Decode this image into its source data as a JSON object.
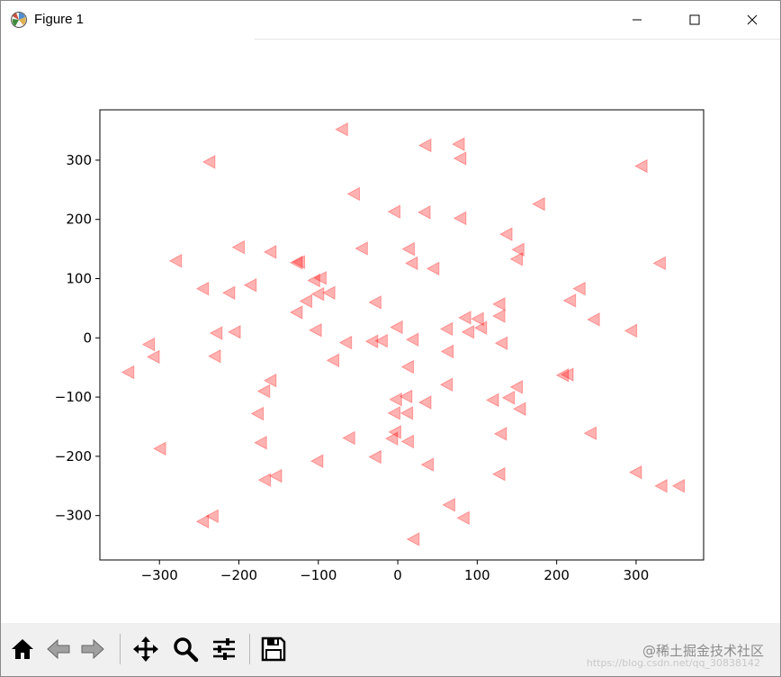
{
  "window": {
    "title": "Figure 1",
    "icon": "matplotlib-logo-icon",
    "controls": [
      "minimize-icon",
      "maximize-icon",
      "close-icon"
    ]
  },
  "toolbar": {
    "buttons": [
      "home-icon",
      "back-arrow-icon",
      "forward-arrow-icon",
      "pan-icon",
      "zoom-icon",
      "configure-subplots-icon",
      "save-icon"
    ],
    "watermark": "@稀土掘金技术社区",
    "watermark_url": "https://blog.csdn.net/qq_30838142"
  },
  "chart_data": {
    "type": "scatter",
    "marker": "triangle-left",
    "color": "#ff0000",
    "alpha": 0.3,
    "title": "",
    "xlabel": "",
    "ylabel": "",
    "xlim": [
      -375,
      385
    ],
    "ylim": [
      -375,
      385
    ],
    "xticks": [
      -300,
      -200,
      -100,
      0,
      100,
      200,
      300
    ],
    "yticks": [
      -300,
      -200,
      -100,
      0,
      100,
      200,
      300
    ],
    "grid": false,
    "points": [
      [
        -70,
        352
      ],
      [
        -237,
        297
      ],
      [
        35,
        325
      ],
      [
        77,
        327
      ],
      [
        79,
        303
      ],
      [
        307,
        290
      ],
      [
        -55,
        243
      ],
      [
        -4,
        213
      ],
      [
        34,
        212
      ],
      [
        79,
        202
      ],
      [
        178,
        226
      ],
      [
        137,
        175
      ],
      [
        -200,
        153
      ],
      [
        -160,
        145
      ],
      [
        -45,
        151
      ],
      [
        14,
        150
      ],
      [
        152,
        149
      ],
      [
        -279,
        130
      ],
      [
        -124,
        128
      ],
      [
        -127,
        127
      ],
      [
        18,
        126
      ],
      [
        45,
        117
      ],
      [
        150,
        133
      ],
      [
        330,
        126
      ],
      [
        -97,
        101
      ],
      [
        -105,
        97
      ],
      [
        -245,
        83
      ],
      [
        -212,
        76
      ],
      [
        -185,
        89
      ],
      [
        -86,
        76
      ],
      [
        -100,
        74
      ],
      [
        -115,
        62
      ],
      [
        -28,
        60
      ],
      [
        229,
        83
      ],
      [
        217,
        63
      ],
      [
        128,
        57
      ],
      [
        -127,
        43
      ],
      [
        -205,
        10
      ],
      [
        -228,
        8
      ],
      [
        -103,
        13
      ],
      [
        -1,
        18
      ],
      [
        62,
        15
      ],
      [
        85,
        34
      ],
      [
        101,
        32
      ],
      [
        105,
        17
      ],
      [
        89,
        10
      ],
      [
        128,
        37
      ],
      [
        247,
        31
      ],
      [
        294,
        12
      ],
      [
        -313,
        -11
      ],
      [
        -307,
        -32
      ],
      [
        -339,
        -58
      ],
      [
        -65,
        -8
      ],
      [
        -32,
        -6
      ],
      [
        -20,
        -5
      ],
      [
        19,
        -3
      ],
      [
        131,
        -9
      ],
      [
        63,
        -23
      ],
      [
        -230,
        -31
      ],
      [
        -81,
        -38
      ],
      [
        13,
        -49
      ],
      [
        -160,
        -72
      ],
      [
        -168,
        -90
      ],
      [
        62,
        -79
      ],
      [
        150,
        -83
      ],
      [
        -2,
        -104
      ],
      [
        11,
        -99
      ],
      [
        35,
        -109
      ],
      [
        120,
        -105
      ],
      [
        140,
        -101
      ],
      [
        154,
        -120
      ],
      [
        208,
        -63
      ],
      [
        214,
        -62
      ],
      [
        -176,
        -128
      ],
      [
        -4,
        -127
      ],
      [
        12,
        -127
      ],
      [
        -3,
        -159
      ],
      [
        -299,
        -187
      ],
      [
        -172,
        -177
      ],
      [
        -61,
        -169
      ],
      [
        -7,
        -170
      ],
      [
        13,
        -175
      ],
      [
        130,
        -162
      ],
      [
        243,
        -161
      ],
      [
        -28,
        -201
      ],
      [
        -101,
        -208
      ],
      [
        38,
        -214
      ],
      [
        128,
        -230
      ],
      [
        -153,
        -233
      ],
      [
        -167,
        -240
      ],
      [
        300,
        -227
      ],
      [
        332,
        -250
      ],
      [
        354,
        -250
      ],
      [
        65,
        -282
      ],
      [
        83,
        -304
      ],
      [
        -245,
        -310
      ],
      [
        -233,
        -301
      ],
      [
        20,
        -340
      ]
    ]
  }
}
